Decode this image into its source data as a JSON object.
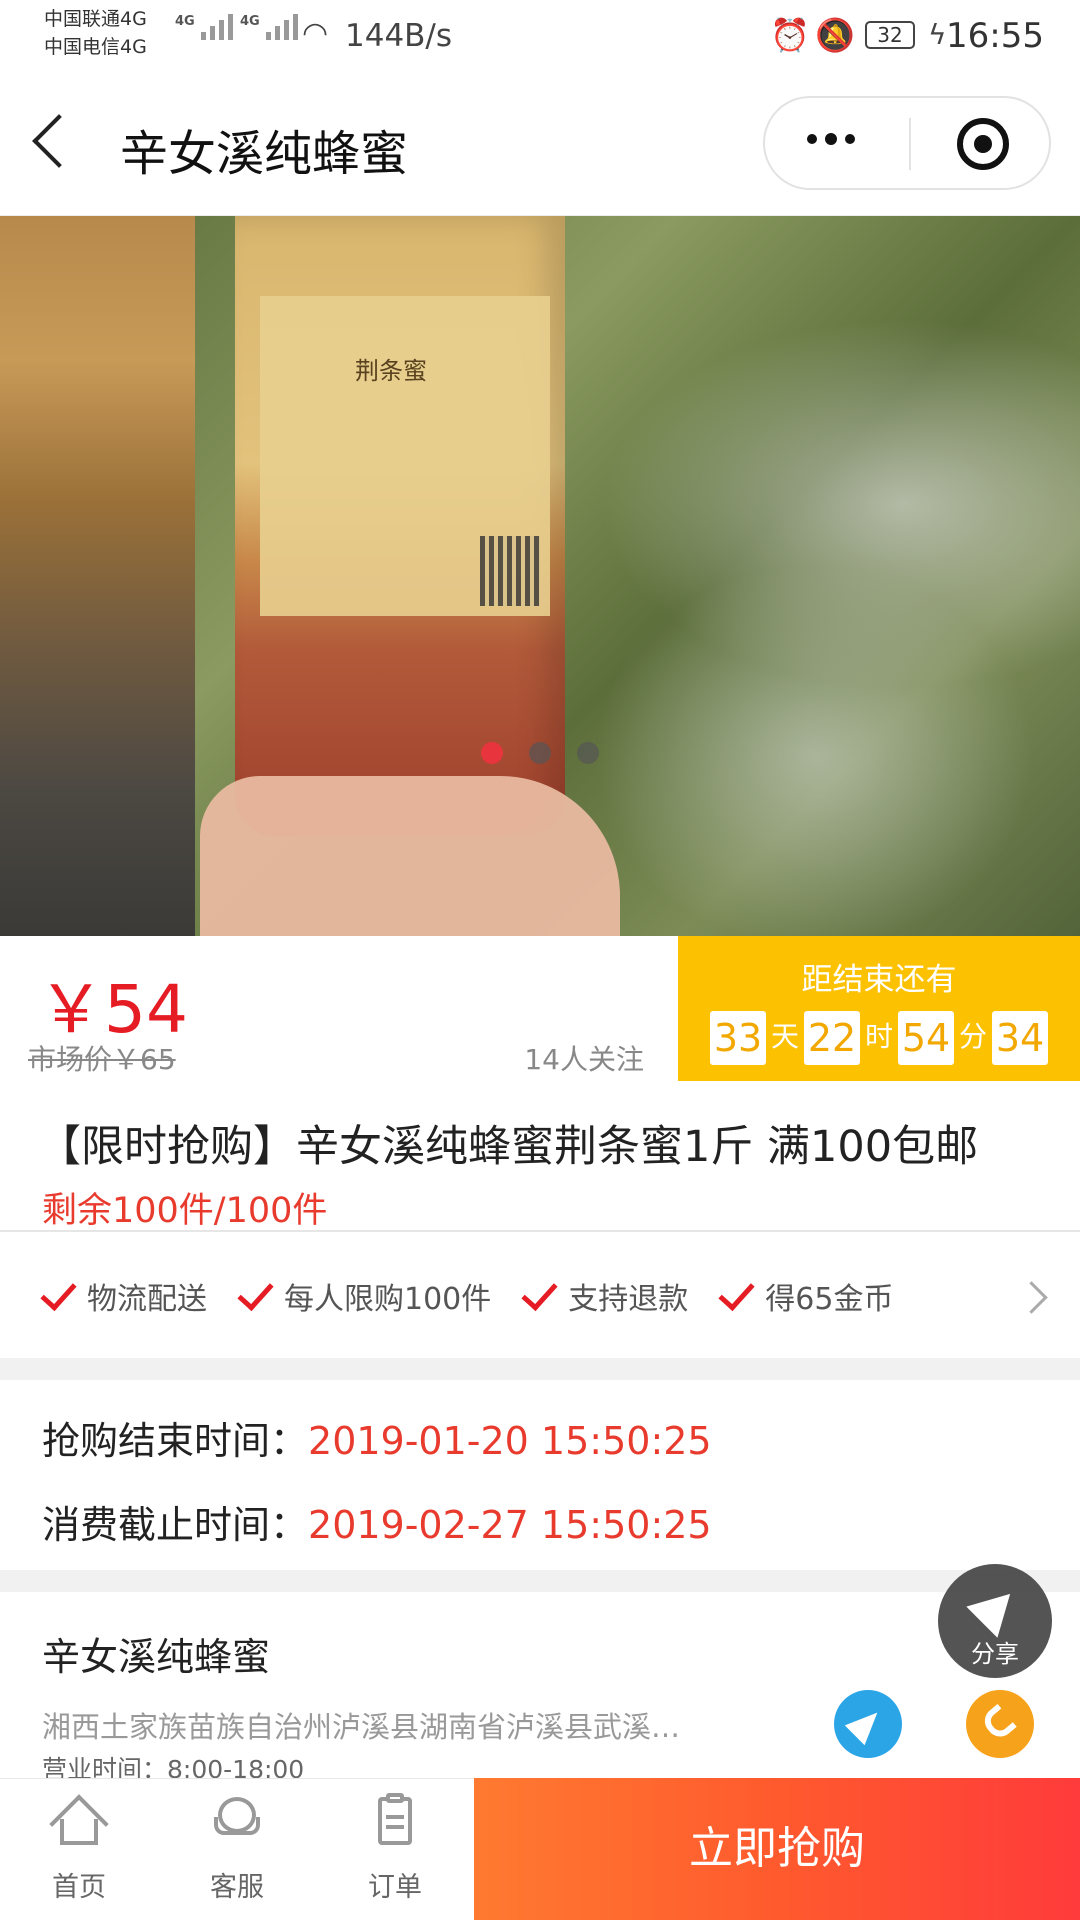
{
  "status_bar": {
    "carrier1": "中国联通4G",
    "carrier2": "中国电信4G",
    "net_type1": "4G",
    "net_type2": "4G",
    "speed": "144B/s",
    "battery": "32",
    "time": "16:55"
  },
  "nav": {
    "title": "辛女溪纯蜂蜜",
    "icons": [
      "back-icon",
      "more-icon",
      "close-target-icon"
    ]
  },
  "banner": {
    "label_text": "荆条蜜",
    "page_count": 3,
    "active_index": 0,
    "indicator_colors": {
      "active": "#e8353d",
      "inactive": "#555555"
    }
  },
  "price": {
    "current": "￥54",
    "market": "市场价￥65",
    "followers": "14人关注"
  },
  "countdown": {
    "title": "距结束还有",
    "days": "33",
    "days_unit": "天",
    "hours": "22",
    "hours_unit": "时",
    "minutes": "54",
    "minutes_unit": "分",
    "seconds": "34"
  },
  "product": {
    "title": "【限时抢购】辛女溪纯蜂蜜荆条蜜1斤 满100包邮",
    "stock": "剩余100件/100件"
  },
  "features": [
    {
      "label": "物流配送"
    },
    {
      "label": "每人限购100件"
    },
    {
      "label": "支持退款"
    },
    {
      "label": "得65金币"
    }
  ],
  "times": {
    "end_label": "抢购结束时间：",
    "end_value": "2019-01-20 15:50:25",
    "expire_label": "消费截止时间：",
    "expire_value": "2019-02-27 15:50:25"
  },
  "shop": {
    "name": "辛女溪纯蜂蜜",
    "address": "湘西土家族苗族自治州泸溪县湖南省泸溪县武溪…",
    "hours": "营业时间：8:00-18:00"
  },
  "share": {
    "label": "分享"
  },
  "tabbar": {
    "home": "首页",
    "service": "客服",
    "orders": "订单"
  },
  "buy_button": "立即抢购",
  "colors": {
    "accent_red": "#e61c24",
    "countdown_bg": "#fcc100",
    "buy_gradient_start": "#ff7a30",
    "buy_gradient_end": "#ff3b3b",
    "nav_btn": "#2ba5e6",
    "call_btn": "#f7a21b"
  }
}
